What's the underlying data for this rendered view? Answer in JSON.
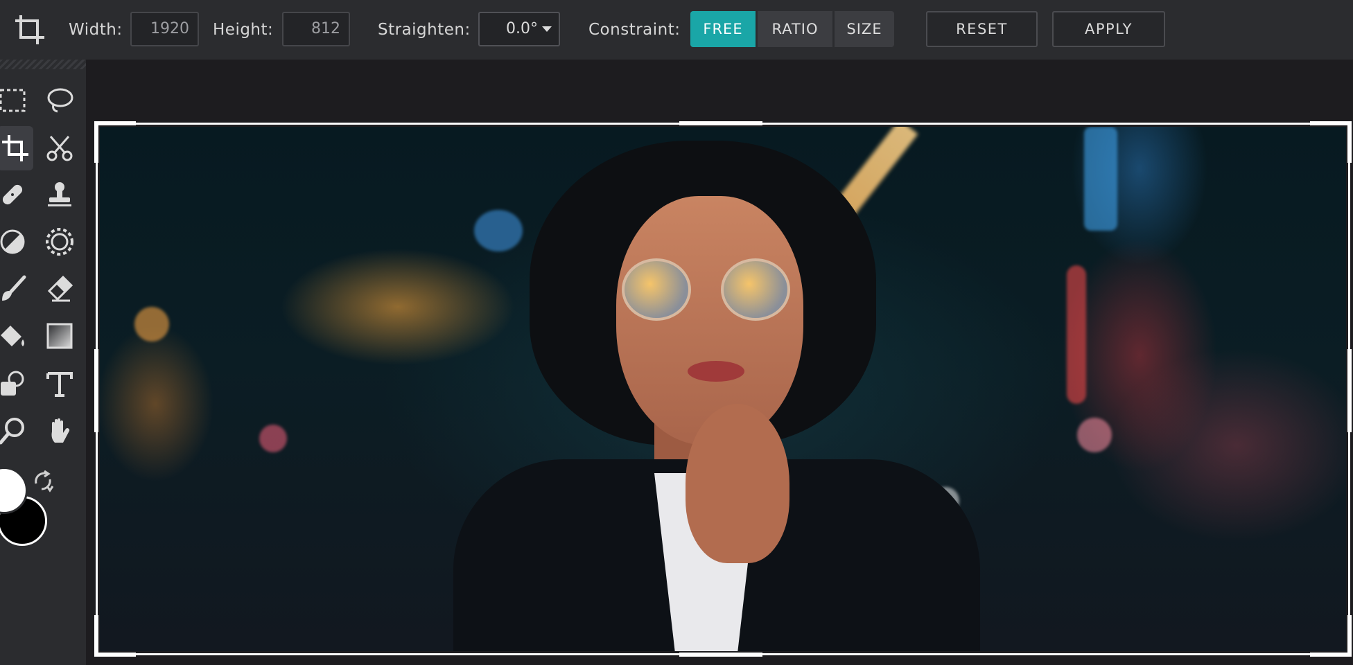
{
  "topbar": {
    "width_label": "Width:",
    "width_value": "1920",
    "height_label": "Height:",
    "height_value": "812",
    "straighten_label": "Straighten:",
    "straighten_value": "0.0°",
    "constraint_label": "Constraint:",
    "constraint_options": [
      "FREE",
      "RATIO",
      "SIZE"
    ],
    "constraint_selected": "FREE",
    "reset_label": "RESET",
    "apply_label": "APPLY"
  },
  "colors": {
    "accent": "#1aa6a7",
    "foreground": "#ffffff",
    "background": "#000000"
  },
  "tools": [
    {
      "name": "marquee-icon"
    },
    {
      "name": "lasso-icon"
    },
    {
      "name": "crop-icon",
      "active": true
    },
    {
      "name": "scissors-icon"
    },
    {
      "name": "bandage-icon"
    },
    {
      "name": "stamp-icon"
    },
    {
      "name": "dodge-icon"
    },
    {
      "name": "brightness-icon"
    },
    {
      "name": "brush-icon"
    },
    {
      "name": "eraser-icon"
    },
    {
      "name": "paint-bucket-icon"
    },
    {
      "name": "gradient-icon"
    },
    {
      "name": "shapes-icon"
    },
    {
      "name": "text-icon"
    },
    {
      "name": "zoom-icon"
    },
    {
      "name": "hand-icon"
    }
  ]
}
